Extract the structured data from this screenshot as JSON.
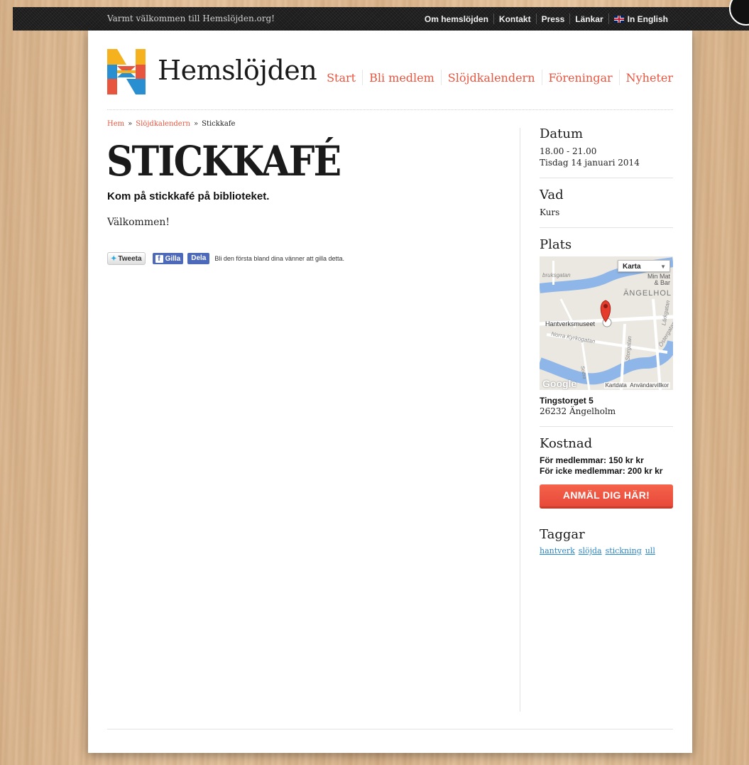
{
  "topbar": {
    "welcome": "Varmt välkommen till Hemslöjden.org!",
    "links": [
      "Om hemslöjden",
      "Kontakt",
      "Press",
      "Länkar"
    ],
    "english": "In English"
  },
  "header": {
    "brand": "Hemslöjden",
    "nav": [
      "Start",
      "Bli medlem",
      "Slöjdkalendern",
      "Föreningar",
      "Nyheter"
    ]
  },
  "breadcrumb": {
    "items": [
      "Hem",
      "Slöjdkalendern"
    ],
    "separator": "»",
    "current": "Stickkafe"
  },
  "article": {
    "title": "STICKKAFÉ",
    "lead": "Kom på stickkafé på biblioteket.",
    "body": "Välkommen!"
  },
  "social": {
    "tweet": "Tweeta",
    "like": "Gilla",
    "share": "Dela",
    "note": "Bli den första bland dina vänner att gilla detta."
  },
  "sidebar": {
    "datum": {
      "heading": "Datum",
      "time": "18.00 - 21.00",
      "date": "Tisdag 14 januari 2014"
    },
    "vad": {
      "heading": "Vad",
      "value": "Kurs"
    },
    "plats": {
      "heading": "Plats",
      "map": {
        "dropdown": "Karta",
        "place_label": "Hantverksmuseet",
        "district": "ÄNGELHOL",
        "poi": [
          "Min Mat",
          "& Bar"
        ],
        "streets": [
          "Norra Kyrkogatan",
          "Storgatan",
          "Lärkgatan",
          "Östergatan",
          "Sodra",
          "bruksgatan"
        ],
        "attribution": "Kartdata",
        "terms": "Användarvillkor",
        "logo": "Google"
      },
      "street": "Tingstorget 5",
      "city": "26232 Ängelholm"
    },
    "kostnad": {
      "heading": "Kostnad",
      "members": "För medlemmar: 150 kr kr",
      "non_members": "För icke medlemmar: 200 kr kr"
    },
    "signup": "ANMÄL DIG HÄR!",
    "taggar": {
      "heading": "Taggar",
      "tags": [
        "hantverk",
        "slöjda",
        "stickning",
        "ull"
      ]
    }
  },
  "colors": {
    "accent": "#e8553f",
    "button": "#f05a44",
    "link": "#2a88c8",
    "topbar": "#1c1c1c"
  }
}
